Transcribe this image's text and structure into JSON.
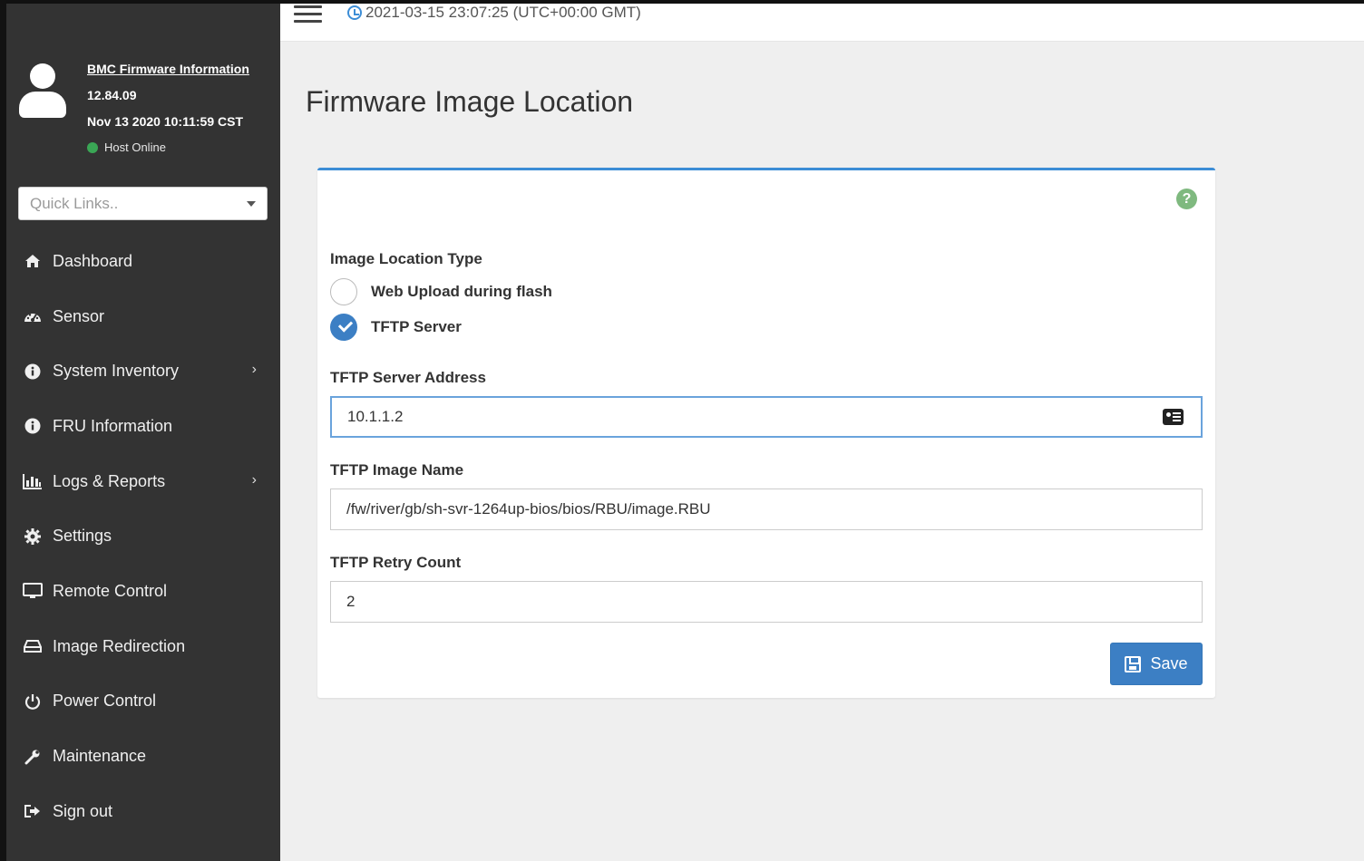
{
  "sidebar": {
    "firmware_link": "BMC Firmware Information",
    "firmware_version": "12.84.09",
    "firmware_date": "Nov 13 2020 10:11:59 CST",
    "host_status": "Host Online",
    "status_color": "#3aa655",
    "quick_links_placeholder": "Quick Links..",
    "items": [
      {
        "label": "Dashboard",
        "icon": "home-icon"
      },
      {
        "label": "Sensor",
        "icon": "dashboard-gauge-icon"
      },
      {
        "label": "System Inventory",
        "icon": "info-icon",
        "has_submenu": true
      },
      {
        "label": "FRU Information",
        "icon": "info-icon"
      },
      {
        "label": "Logs & Reports",
        "icon": "bar-chart-icon",
        "has_submenu": true
      },
      {
        "label": "Settings",
        "icon": "gear-icon"
      },
      {
        "label": "Remote Control",
        "icon": "monitor-icon"
      },
      {
        "label": "Image Redirection",
        "icon": "drive-icon"
      },
      {
        "label": "Power Control",
        "icon": "power-icon"
      },
      {
        "label": "Maintenance",
        "icon": "wrench-icon"
      },
      {
        "label": "Sign out",
        "icon": "sign-out-icon"
      }
    ]
  },
  "topbar": {
    "datetime": "2021-03-15 23:07:25 (UTC+00:00 GMT)"
  },
  "page": {
    "title": "Firmware Image Location"
  },
  "form": {
    "image_location_type_label": "Image Location Type",
    "options": [
      {
        "label": "Web Upload during flash",
        "checked": false
      },
      {
        "label": "TFTP Server",
        "checked": true
      }
    ],
    "tftp_address_label": "TFTP Server Address",
    "tftp_address_value": "10.1.1.2",
    "tftp_image_label": "TFTP Image Name",
    "tftp_image_value": "/fw/river/gb/sh-svr-1264up-bios/bios/RBU/image.RBU",
    "tftp_retry_label": "TFTP Retry Count",
    "tftp_retry_value": "2",
    "save_label": "Save"
  },
  "colors": {
    "accent": "#3c7fc4",
    "sidebar_bg": "#333333",
    "help_icon": "#7fb97f"
  }
}
